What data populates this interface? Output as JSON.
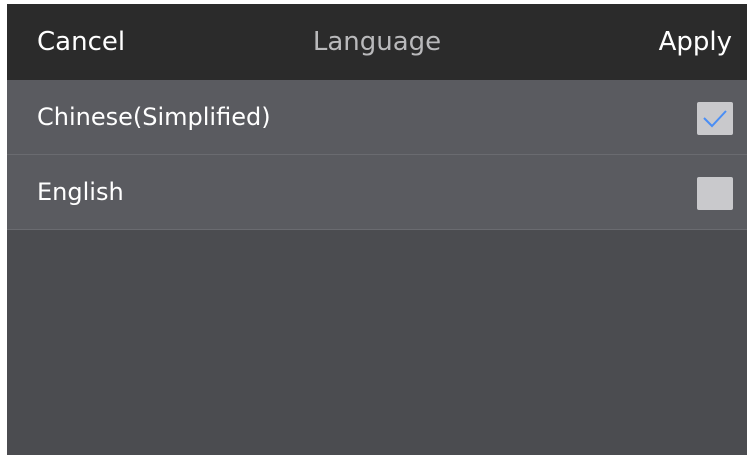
{
  "header": {
    "cancel_label": "Cancel",
    "title": "Language",
    "apply_label": "Apply"
  },
  "languages": [
    {
      "label": "Chinese(Simplified)",
      "checked": true
    },
    {
      "label": "English",
      "checked": false
    }
  ],
  "colors": {
    "header_bg": "#2b2b2b",
    "row_bg": "#5a5b60",
    "panel_bg": "#4b4c50",
    "check_accent": "#4a8ef5",
    "checkbox_bg": "#c9c9cc"
  },
  "icons": {
    "checked": "checkmark-icon"
  }
}
